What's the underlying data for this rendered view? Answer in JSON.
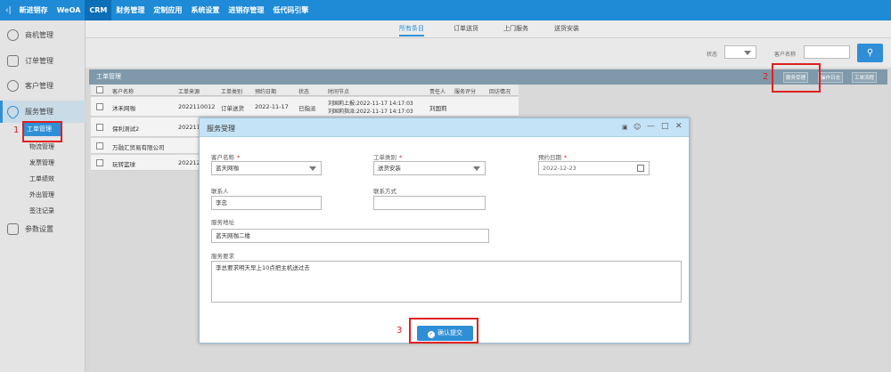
{
  "topbar": {
    "back": "‹|",
    "nav": [
      "新进销存",
      "WeOA",
      "CRM",
      "财务管理",
      "定制应用",
      "系统设置",
      "进销存管理",
      "低代码引擎"
    ],
    "active_index": 2
  },
  "sidebar": {
    "items": [
      {
        "label": "商机管理",
        "icon": "business-icon"
      },
      {
        "label": "订单管理",
        "icon": "order-icon"
      },
      {
        "label": "客户管理",
        "icon": "customer-icon"
      },
      {
        "label": "服务管理",
        "icon": "heart-icon"
      },
      {
        "label": "参数设置",
        "icon": "settings-icon"
      }
    ],
    "sub_items": [
      "工单管理",
      "物流管理",
      "发票管理",
      "工单绩效",
      "外出管理",
      "签注记录"
    ]
  },
  "tabs": [
    "所有条目",
    "订单送货",
    "上门服务",
    "送货安装"
  ],
  "filter": {
    "status_label": "状态",
    "customer_label": "客户名称"
  },
  "panel": {
    "title": "工单管理",
    "buttons": [
      "服务受理",
      "操作日志",
      "工单流程"
    ]
  },
  "table": {
    "columns": [
      "客户名称",
      "工单来源",
      "工单类别",
      "预约日期",
      "状态",
      "时间节点",
      "责任人",
      "服务评分",
      "回访情况"
    ],
    "rows": [
      {
        "customer": "沐禾网咖",
        "source": "2022110012",
        "type": "订单送货",
        "date": "2022-11-17",
        "status": "已指派",
        "nodes": [
          "刘国莉上报:2022-11-17 14:17:03",
          "刘国莉指派:2022-11-17 14:17:03"
        ],
        "owner": "刘国莉"
      },
      {
        "customer": "保利测试2",
        "source": "2022110"
      },
      {
        "customer": "万融汇贸易有限公司",
        "source": ""
      },
      {
        "customer": "玩转篮球",
        "source": "202212"
      }
    ]
  },
  "modal": {
    "title": "服务受理",
    "fields": {
      "customer_label": "客户名称",
      "customer_value": "蓝天网咖",
      "type_label": "工单类别",
      "type_value": "送货安装",
      "date_label": "预约日期",
      "date_value": "2022-12-23",
      "contact_label": "联系人",
      "contact_value": "李忠",
      "phone_label": "联系方式",
      "phone_value": "",
      "address_label": "服务地址",
      "address_value": "蓝天网咖二楼",
      "request_label": "服务要求",
      "request_value": "李总要求明天早上10点把主机送过去"
    },
    "required_mark": "*",
    "submit_label": "确认提交"
  },
  "annotations": [
    "1",
    "2",
    "3"
  ],
  "colors": {
    "accent": "#2f8fd6",
    "topbar": "#1f8ad6",
    "highlight": "#e02020"
  }
}
